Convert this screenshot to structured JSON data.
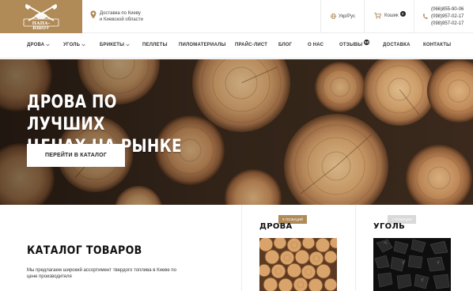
{
  "header": {
    "logo_text": "ПАПА-ВШОУ",
    "delivery_line1": "Доставка по Киеву",
    "delivery_line2": "и Киевской области",
    "lang_label": "Укр/Рус",
    "cart_label": "Кошик",
    "cart_count": "0",
    "phones": [
      "(066)855-90-06",
      "(098)957-02-17",
      "(098)957-02-17"
    ]
  },
  "nav": {
    "items": [
      {
        "label": "ДРОВА",
        "dropdown": true
      },
      {
        "label": "УГОЛЬ",
        "dropdown": true
      },
      {
        "label": "БРИКЕТЫ",
        "dropdown": true
      },
      {
        "label": "ПЕЛЛЕТЫ",
        "dropdown": false
      },
      {
        "label": "ПИЛОМАТЕРИАЛЫ",
        "dropdown": false
      },
      {
        "label": "ПРАЙС-ЛИСТ",
        "dropdown": false
      },
      {
        "label": "БЛОГ",
        "dropdown": false
      },
      {
        "label": "О НАС",
        "dropdown": false
      },
      {
        "label": "ОТЗЫВЫ",
        "dropdown": false,
        "badge": "50"
      },
      {
        "label": "ДОСТАВКА",
        "dropdown": false
      },
      {
        "label": "КОНТАКТЫ",
        "dropdown": false
      }
    ]
  },
  "hero": {
    "title_line1": "ДРОВА ПО ЛУЧШИХ",
    "title_line2": "ЦЕНАХ НА РЫНКЕ",
    "button_label": "ПЕРЕЙТИ В КАТАЛОГ"
  },
  "catalog": {
    "title": "КАТАЛОГ ТОВАРОВ",
    "description": "Мы предлагаем широкий ассортимент твердого топлива в Киеве по цене производителя",
    "cards": [
      {
        "name": "ДРОВА",
        "badge": "9 ПОЗИЦИЙ",
        "badge_color": "#b08a57"
      },
      {
        "name": "УГОЛЬ",
        "badge": "1 ПОЗИЦИЯ",
        "badge_color": "#d9d9d9"
      }
    ]
  },
  "colors": {
    "accent": "#b08a57",
    "dark": "#222222"
  }
}
